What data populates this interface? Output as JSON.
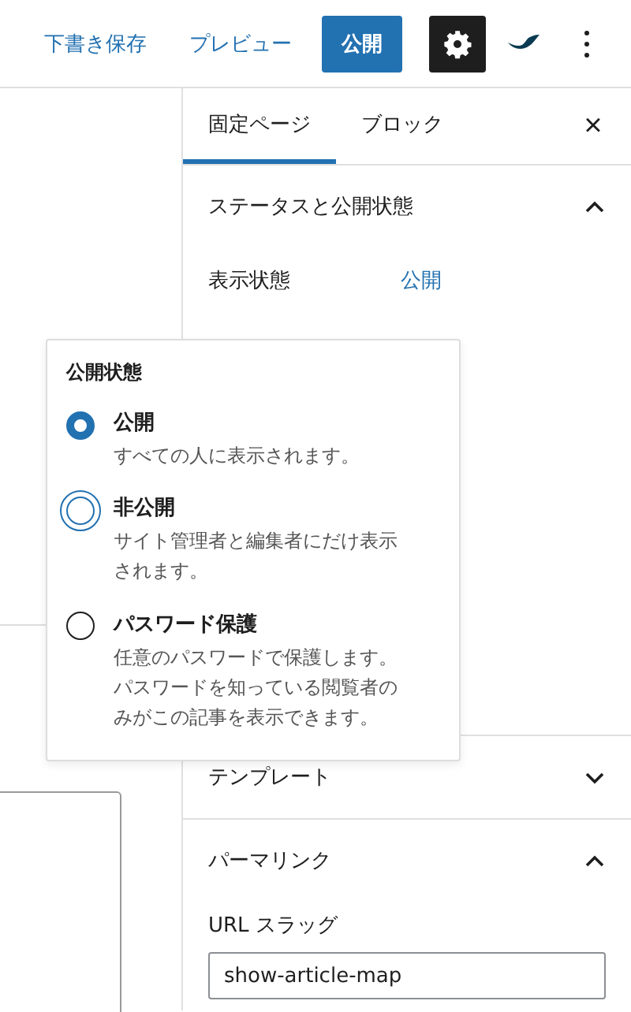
{
  "toolbar": {
    "save_draft": "下書き保存",
    "preview": "プレビュー",
    "publish": "公開",
    "settings_active": true
  },
  "sidebar": {
    "tabs": [
      {
        "label": "固定ページ",
        "selected": true
      },
      {
        "label": "ブロック",
        "selected": false
      }
    ],
    "close": "×",
    "sections": [
      {
        "title": "ステータスと公開状態",
        "expanded": true,
        "rows": [
          {
            "label": "表示状態",
            "value": "公開"
          }
        ]
      },
      {
        "title": "テンプレート",
        "expanded": false
      },
      {
        "title": "パーマリンク",
        "expanded": true,
        "field_label": "URL スラッグ",
        "field_value": "show-article-map"
      }
    ]
  },
  "popover": {
    "title": "公開状態",
    "options": [
      {
        "label": "公開",
        "description": "すべての人に表示されます。",
        "selected": true,
        "focused": false
      },
      {
        "label": "非公開",
        "description": "サイト管理者と編集者にだけ表示されます。",
        "selected": false,
        "focused": true
      },
      {
        "label": "パスワード保護",
        "description": "任意のパスワードで保護します。パスワードを知っている閲覧者のみがこの記事を表示できます。",
        "selected": false,
        "focused": false
      }
    ]
  }
}
